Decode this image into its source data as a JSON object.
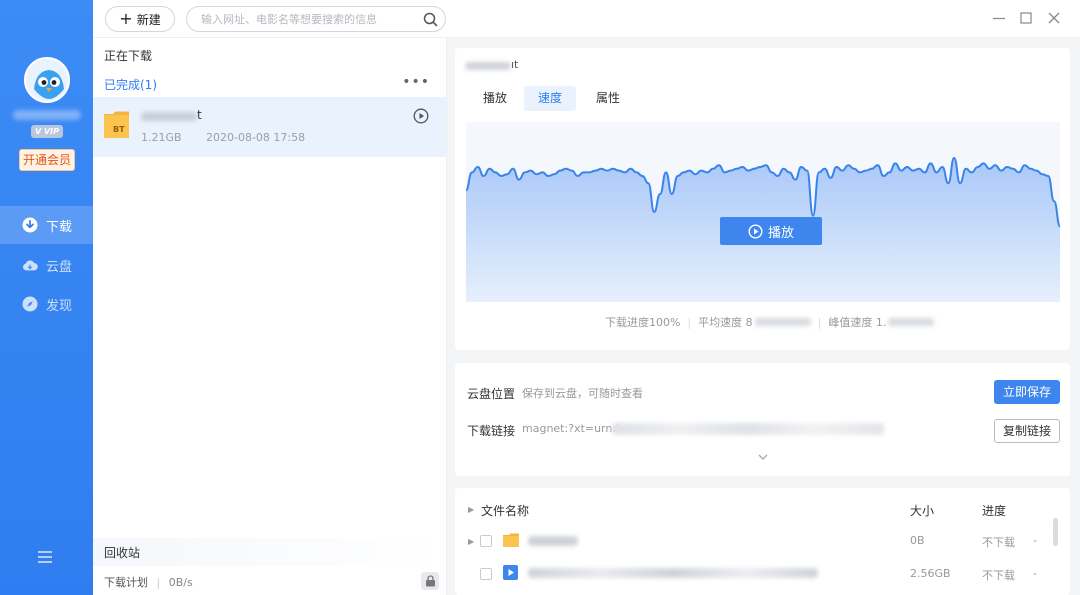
{
  "topbar": {
    "new_label": "新建",
    "search_placeholder": "输入网址、电影名等想要搜索的信息"
  },
  "user": {
    "vip_badge": "V VIP",
    "open_vip": "开通会员"
  },
  "nav": {
    "items": [
      {
        "label": "下载",
        "icon": "download-icon",
        "active": true
      },
      {
        "label": "云盘",
        "icon": "cloud-icon",
        "active": false
      },
      {
        "label": "发现",
        "icon": "compass-icon",
        "active": false
      }
    ]
  },
  "list": {
    "downloading_title": "正在下载",
    "completed_title": "已完成(1)",
    "more": "•••",
    "task": {
      "name_tail": "t",
      "size": "1.21GB",
      "date": "2020-08-08 17:58",
      "badge": "BT"
    },
    "recycle_bin": "回收站",
    "footer_plan": "下载计划",
    "footer_speed": "0B/s"
  },
  "detail": {
    "title_tail": "ıt",
    "tabs": [
      {
        "label": "播放",
        "active": false
      },
      {
        "label": "速度",
        "active": true
      },
      {
        "label": "属性",
        "active": false
      }
    ],
    "play_label": "播放",
    "stats": {
      "progress": "下载进度100%",
      "avg_speed_prefix": "平均速度 8",
      "peak_speed_prefix": "峰值速度 1."
    },
    "cloud": {
      "label": "云盘位置",
      "value": "保存到云盘，可随时查看",
      "save_button": "立即保存"
    },
    "link": {
      "label": "下载链接",
      "value": "magnet:?xt=urn:l",
      "copy_button": "复制链接"
    },
    "files": {
      "headers": {
        "name": "文件名称",
        "size": "大小",
        "progress": "进度"
      },
      "rows": [
        {
          "size": "0B",
          "status": "不下载",
          "dash": "-",
          "type": "folder"
        },
        {
          "size": "2.56GB",
          "status": "不下载",
          "dash": "-",
          "type": "video"
        }
      ]
    }
  },
  "colors": {
    "brand": "#2f7df0",
    "rail": "#3d8bf5",
    "vip_text": "#e3541c"
  },
  "chart_data": {
    "type": "area",
    "title": "",
    "xlabel": "",
    "ylabel": "",
    "ylim": [
      0,
      100
    ],
    "values": [
      62,
      72,
      75,
      70,
      74,
      72,
      70,
      71,
      74,
      68,
      72,
      73,
      71,
      72,
      70,
      71,
      73,
      74,
      73,
      70,
      72,
      72,
      73,
      74,
      73,
      74,
      73,
      72,
      74,
      72,
      70,
      66,
      50,
      60,
      72,
      60,
      70,
      72,
      73,
      71,
      73,
      72,
      74,
      76,
      72,
      73,
      74,
      75,
      73,
      74,
      75,
      76,
      72,
      70,
      74,
      72,
      68,
      75,
      73,
      48,
      72,
      74,
      69,
      75,
      73,
      76,
      74,
      72,
      73,
      74,
      76,
      70,
      72,
      77,
      73,
      75,
      73,
      74,
      72,
      77,
      72,
      75,
      66,
      80,
      66,
      74,
      72,
      75,
      77,
      74,
      76,
      73,
      75,
      74,
      72,
      76,
      74,
      73,
      71,
      70,
      56,
      42
    ]
  }
}
